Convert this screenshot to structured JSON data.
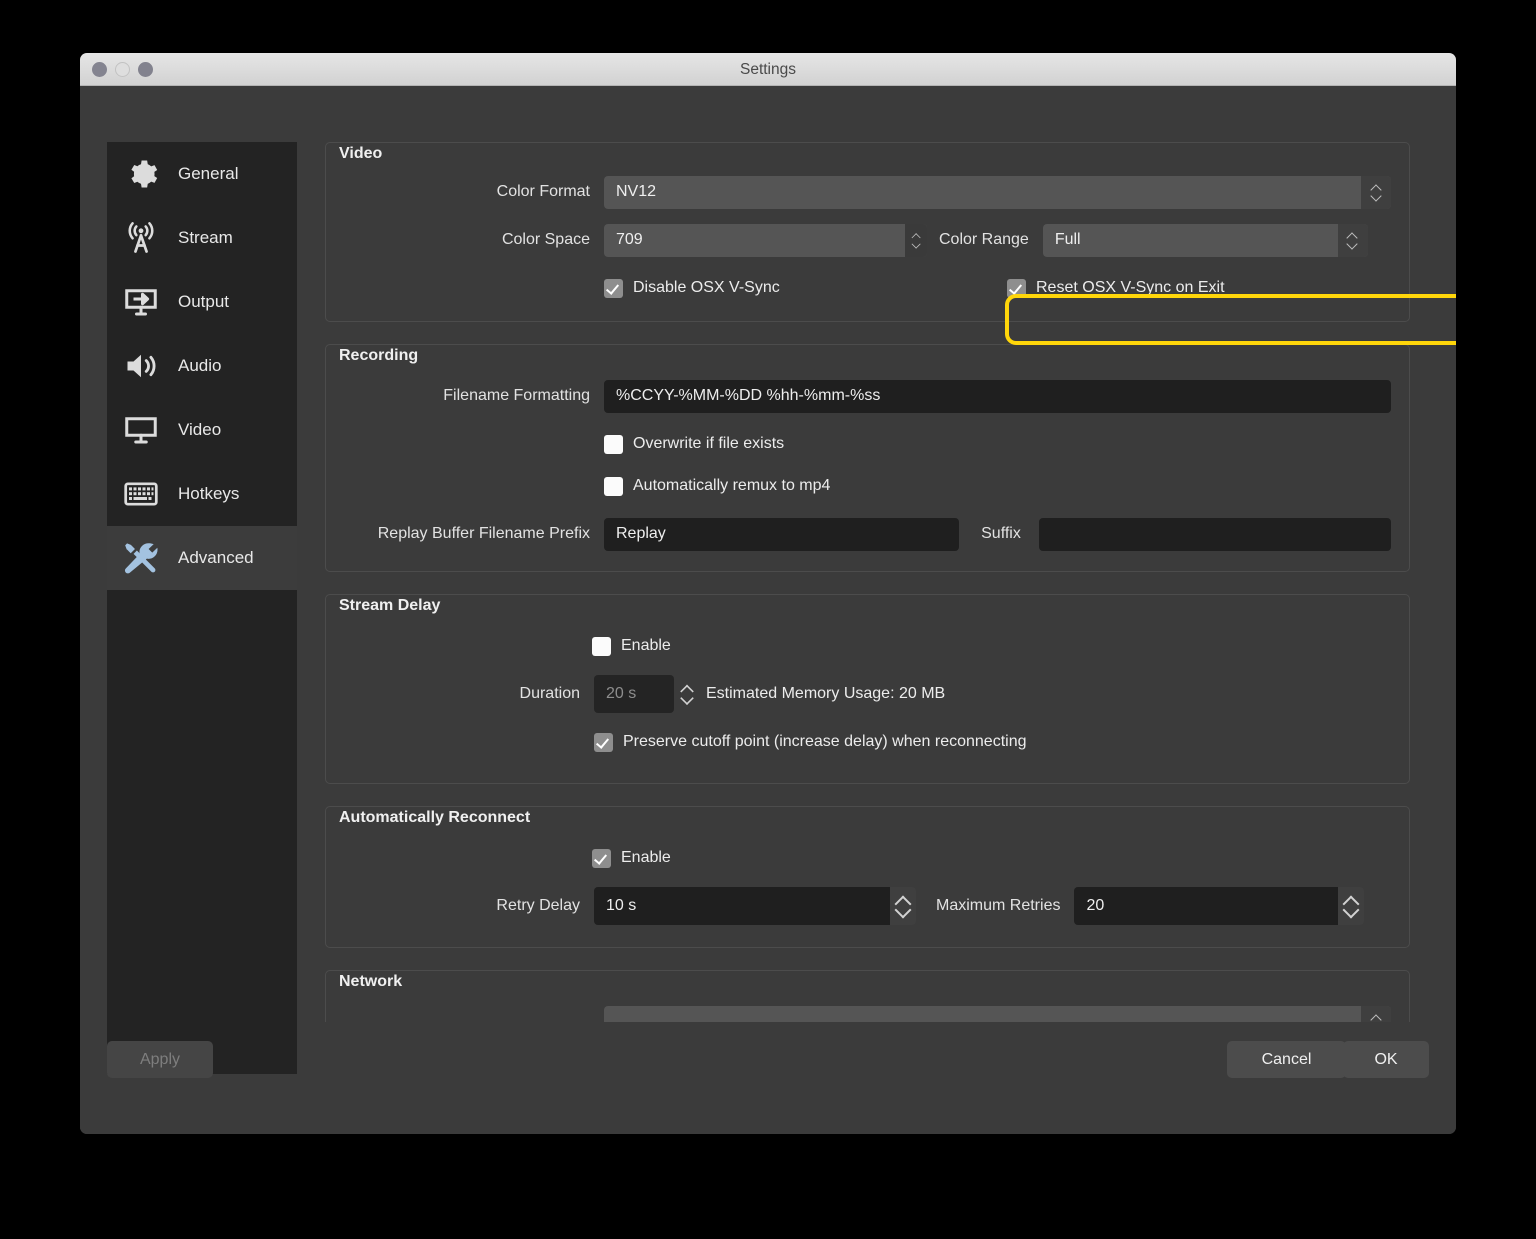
{
  "window": {
    "title": "Settings",
    "traffic_lights": [
      "close",
      "minimize",
      "zoom"
    ]
  },
  "sidebar": {
    "items": [
      {
        "label": "General",
        "icon": "gear-icon",
        "selected": false
      },
      {
        "label": "Stream",
        "icon": "broadcast-icon",
        "selected": false
      },
      {
        "label": "Output",
        "icon": "monitor-arrow-icon",
        "selected": false
      },
      {
        "label": "Audio",
        "icon": "speaker-icon",
        "selected": false
      },
      {
        "label": "Video",
        "icon": "display-icon",
        "selected": false
      },
      {
        "label": "Hotkeys",
        "icon": "keyboard-icon",
        "selected": false
      },
      {
        "label": "Advanced",
        "icon": "tools-icon",
        "selected": true
      }
    ]
  },
  "groups": {
    "video": {
      "title": "Video",
      "color_format_label": "Color Format",
      "color_format_value": "NV12",
      "color_space_label": "Color Space",
      "color_space_value": "709",
      "color_range_label": "Color Range",
      "color_range_value": "Full",
      "disable_vsync_label": "Disable OSX V-Sync",
      "disable_vsync_checked": true,
      "reset_vsync_label": "Reset OSX V-Sync on Exit",
      "reset_vsync_checked": true
    },
    "recording": {
      "title": "Recording",
      "filename_formatting_label": "Filename Formatting",
      "filename_formatting_value": "%CCYY-%MM-%DD %hh-%mm-%ss",
      "overwrite_label": "Overwrite if file exists",
      "overwrite_checked": false,
      "remux_label": "Automatically remux to mp4",
      "remux_checked": false,
      "replay_prefix_label": "Replay Buffer Filename Prefix",
      "replay_prefix_value": "Replay",
      "suffix_label": "Suffix",
      "suffix_value": ""
    },
    "stream_delay": {
      "title": "Stream Delay",
      "enable_label": "Enable",
      "enable_checked": false,
      "duration_label": "Duration",
      "duration_value": "20 s",
      "memory_usage_text": "Estimated Memory Usage: 20 MB",
      "preserve_label": "Preserve cutoff point (increase delay) when reconnecting",
      "preserve_checked": true
    },
    "auto_reconnect": {
      "title": "Automatically Reconnect",
      "enable_label": "Enable",
      "enable_checked": true,
      "retry_delay_label": "Retry Delay",
      "retry_delay_value": "10 s",
      "max_retries_label": "Maximum Retries",
      "max_retries_value": "20"
    },
    "network": {
      "title": "Network"
    }
  },
  "footer": {
    "apply_label": "Apply",
    "cancel_label": "Cancel",
    "ok_label": "OK"
  },
  "colors": {
    "highlight": "#ffd60a",
    "accent_icon": "#a3c2e0",
    "window_bg": "#3b3b3b",
    "sidebar_bg": "#232323"
  }
}
